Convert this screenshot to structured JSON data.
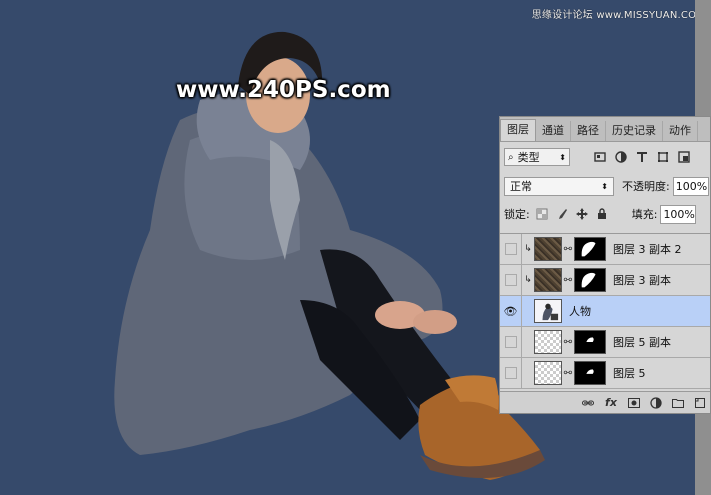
{
  "watermarks": {
    "corner": "思缘设计论坛 www.MISSYUAN.COM",
    "center": "www.240PS.com"
  },
  "layers_panel": {
    "tabs": [
      {
        "label": "图层",
        "active": true
      },
      {
        "label": "通道",
        "active": false
      },
      {
        "label": "路径",
        "active": false
      },
      {
        "label": "历史记录",
        "active": false
      },
      {
        "label": "动作",
        "active": false
      }
    ],
    "filter": {
      "label": "类型",
      "icon": "search-icon"
    },
    "blend_mode": "正常",
    "opacity_label": "不透明度:",
    "opacity_value": "100%",
    "lock_label": "锁定:",
    "fill_label": "填充:",
    "fill_value": "100%",
    "layers": [
      {
        "name": "图层 3 副本 2",
        "visible": false,
        "selected": false,
        "clipped": true,
        "thumb": "texture",
        "has_mask": true
      },
      {
        "name": "图层 3 副本",
        "visible": false,
        "selected": false,
        "clipped": true,
        "thumb": "texture",
        "has_mask": true
      },
      {
        "name": "人物",
        "visible": true,
        "selected": true,
        "clipped": false,
        "thumb": "person",
        "has_mask": false
      },
      {
        "name": "图层 5 副本",
        "visible": false,
        "selected": false,
        "clipped": false,
        "thumb": "checker",
        "has_mask": true
      },
      {
        "name": "图层 5",
        "visible": false,
        "selected": false,
        "clipped": false,
        "thumb": "checker",
        "has_mask": true
      }
    ],
    "bottom_icons": [
      "link-icon",
      "fx-icon",
      "add-mask-icon",
      "adjustment-icon",
      "folder-icon",
      "new-layer-icon"
    ],
    "fx_label": "fx"
  },
  "colors": {
    "canvas_bg": "#364a6b",
    "selected_layer": "#b9d0f7"
  }
}
